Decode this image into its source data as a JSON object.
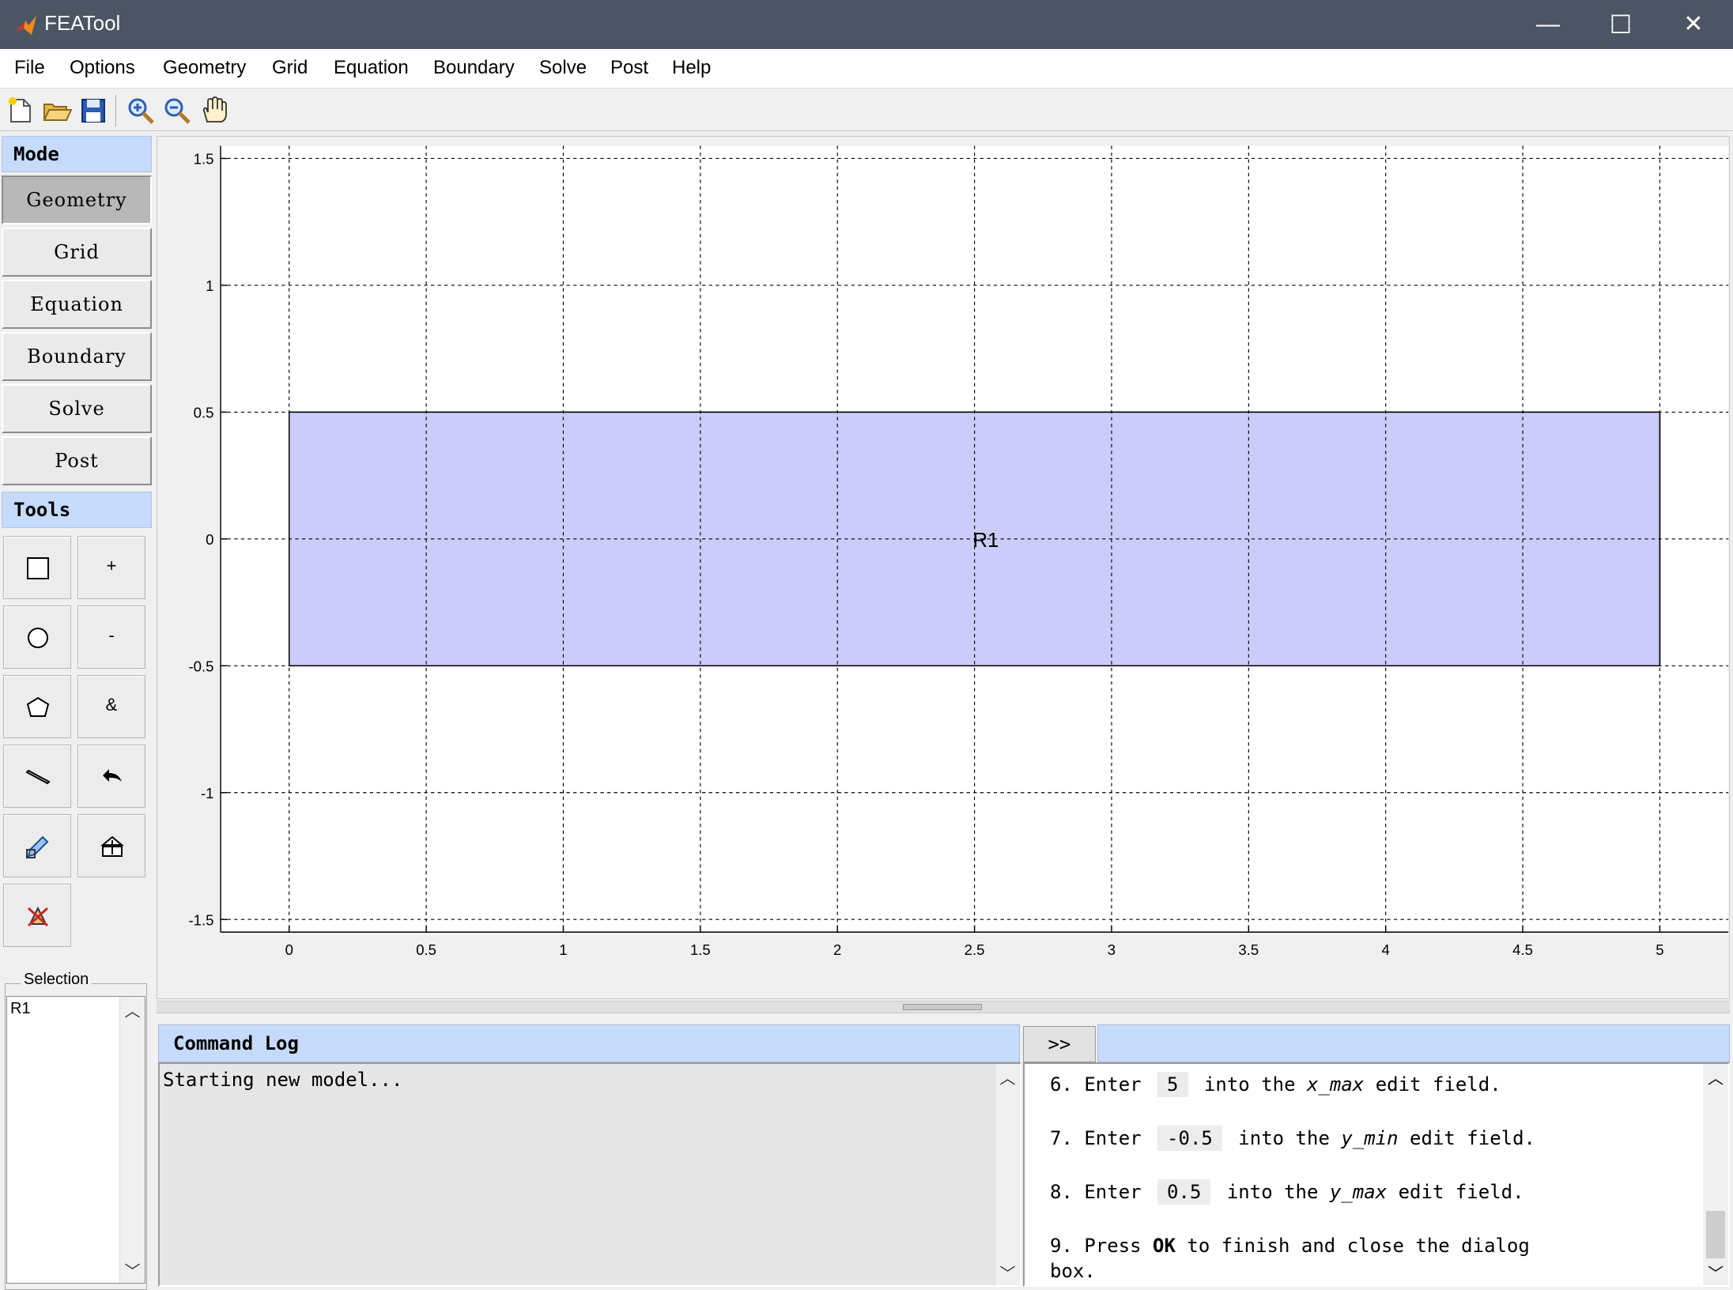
{
  "window": {
    "title": "FEATool",
    "minimize": "—",
    "maximize": "☐",
    "close": "✕"
  },
  "menu": [
    "File",
    "Options",
    "Geometry",
    "Grid",
    "Equation",
    "Boundary",
    "Solve",
    "Post",
    "Help"
  ],
  "toolbar": {
    "icons": [
      "new-file-icon",
      "open-folder-icon",
      "save-icon",
      "zoom-in-icon",
      "zoom-out-icon",
      "pan-hand-icon"
    ]
  },
  "left_panel": {
    "mode_header": "Mode",
    "modes": [
      "Geometry",
      "Grid",
      "Equation",
      "Boundary",
      "Solve",
      "Post"
    ],
    "active_mode": "Geometry",
    "tools_header": "Tools",
    "tools": [
      {
        "name": "rectangle-tool",
        "icon": "rectangle-icon"
      },
      {
        "name": "union-tool",
        "label": "+"
      },
      {
        "name": "circle-tool",
        "icon": "circle-icon"
      },
      {
        "name": "subtract-tool",
        "label": "-"
      },
      {
        "name": "polygon-tool",
        "icon": "polygon-icon"
      },
      {
        "name": "intersect-tool",
        "label": "&"
      },
      {
        "name": "line-tool",
        "icon": "line-icon"
      },
      {
        "name": "undo-tool",
        "icon": "undo-icon"
      },
      {
        "name": "edit-tool",
        "icon": "edit-icon"
      },
      {
        "name": "import-tool",
        "icon": "import-icon"
      },
      {
        "name": "delete-tool",
        "icon": "delete-icon"
      }
    ],
    "selection_label": "Selection",
    "selection_items": [
      "R1"
    ]
  },
  "plot": {
    "xlim": [
      -0.25,
      5.25
    ],
    "ylim": [
      -1.55,
      1.55
    ],
    "xticks": [
      "0",
      "0.5",
      "1",
      "1.5",
      "2",
      "2.5",
      "3",
      "3.5",
      "4",
      "4.5",
      "5"
    ],
    "yticks": [
      "1.5",
      "1",
      "0.5",
      "0",
      "-0.5",
      "-1",
      "-1.5"
    ],
    "grid": "dashed",
    "geometry": {
      "label": "R1",
      "xmin": 0,
      "xmax": 5,
      "ymin": -0.5,
      "ymax": 0.5,
      "fill": "#ccccfa"
    }
  },
  "command_log": {
    "header": "Command Log",
    "text": "Starting new model..."
  },
  "toggle_button": ">>",
  "help": {
    "step6": {
      "prefix": "6. Enter ",
      "value": "5",
      "mid": " into the ",
      "field": "x_max",
      "suffix": " edit field."
    },
    "step7": {
      "prefix": "7. Enter ",
      "value": "-0.5",
      "mid": " into the ",
      "field": "y_min",
      "suffix": " edit field."
    },
    "step8": {
      "prefix": "8. Enter ",
      "value": "0.5",
      "mid": " into the ",
      "field": "y_max",
      "suffix": " edit field."
    },
    "step9": {
      "prefix": "9. Press ",
      "bold": "OK",
      "suffix": " to finish and close the dialog",
      "cont": "box."
    }
  },
  "colors": {
    "titlebar": "#4b5563",
    "header_blue": "#c6dbfb",
    "geometry_fill": "#ccccfa"
  }
}
